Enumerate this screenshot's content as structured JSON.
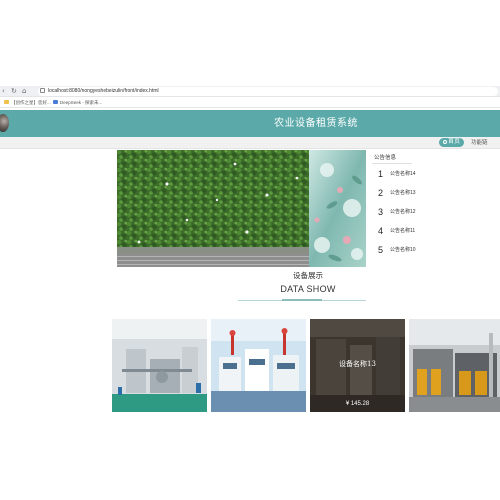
{
  "browser": {
    "url": "localhost:8080/nongyeshebeizulin/front/index.html",
    "bookmarks": [
      {
        "label": "【创作之星】您好..."
      },
      {
        "label": "DeepSeek - 探索未..."
      }
    ]
  },
  "header": {
    "site_title": "农业设备租赁系统",
    "nav": {
      "home_label": "首页",
      "other_label": "功能链"
    }
  },
  "notice": {
    "title": "公告信息",
    "items": [
      {
        "num": "1",
        "label": "公告名称14"
      },
      {
        "num": "2",
        "label": "公告名称13"
      },
      {
        "num": "3",
        "label": "公告名称12"
      },
      {
        "num": "4",
        "label": "公告名称11"
      },
      {
        "num": "5",
        "label": "公告名称10"
      }
    ]
  },
  "section": {
    "title_cn": "设备展示",
    "title_en": "DATA SHOW"
  },
  "products": [
    {
      "image": "factory-production-line"
    },
    {
      "image": "laboratory-equipment"
    },
    {
      "image": "industrial-machinery",
      "name": "设备名称13",
      "price": "¥ 145.28"
    },
    {
      "image": "outdoor-processing-units"
    }
  ],
  "colors": {
    "header_bg": "#5ca9a9",
    "accent": "#5ca9a9"
  }
}
